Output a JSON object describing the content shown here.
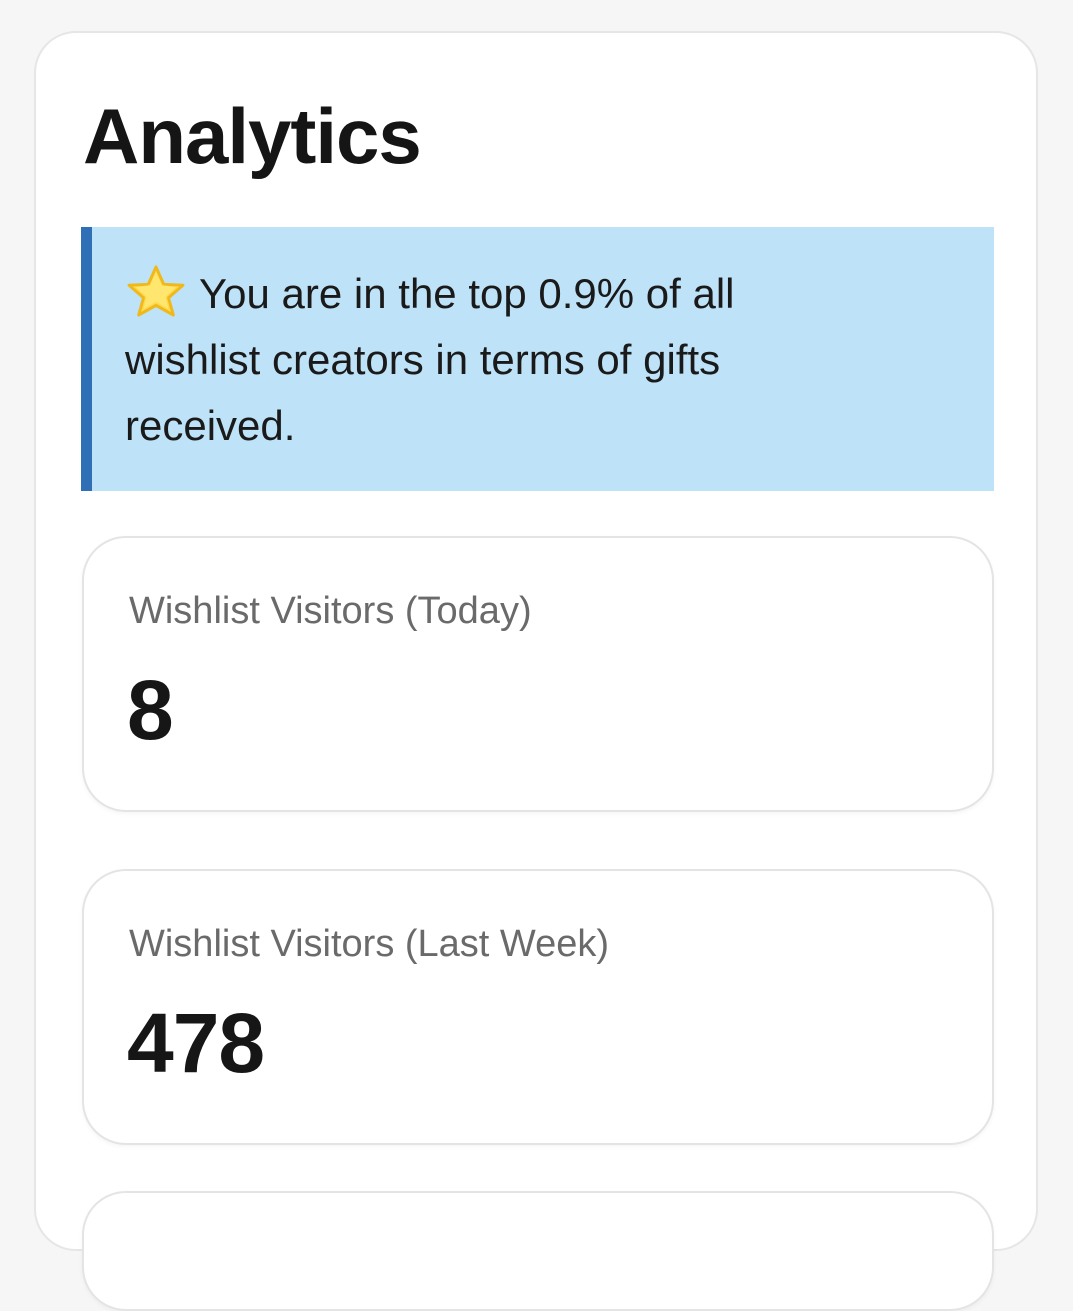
{
  "analytics": {
    "title": "Analytics",
    "notice": {
      "icon": "star-icon",
      "text": "You are in the top 0.9% of all wishlist creators in terms of gifts received."
    },
    "stats": [
      {
        "label": "Wishlist Visitors (Today)",
        "value": "8"
      },
      {
        "label": "Wishlist Visitors (Last Week)",
        "value": "478"
      }
    ]
  },
  "colors": {
    "page_background": "#f6f6f6",
    "card_background": "#ffffff",
    "notice_background": "#bee2f7",
    "notice_accent": "#2f6fb5",
    "muted_text": "#6a6a6a",
    "strong_text": "#161616"
  }
}
